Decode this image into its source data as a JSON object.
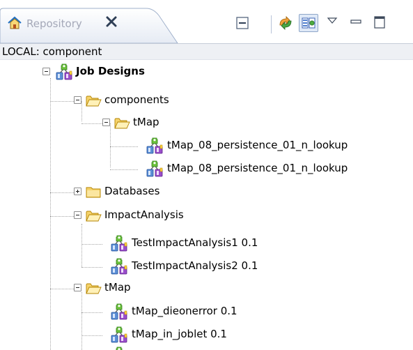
{
  "tab": {
    "title": "Repository",
    "icon": "repository-house-icon"
  },
  "toolbar": [
    {
      "name": "collapse-all-icon"
    },
    {
      "name": "refresh-icon"
    },
    {
      "name": "filter-icon",
      "active": true
    },
    {
      "name": "view-menu-icon"
    },
    {
      "name": "minimize-icon"
    },
    {
      "name": "maximize-icon"
    }
  ],
  "breadcrumb": "LOCAL: component",
  "tree": {
    "job_designs": "Job Designs",
    "components": "components",
    "components_tmap": "tMap",
    "job_lookup_1": "tMap_08_persistence_01_n_lookup",
    "job_lookup_2": "tMap_08_persistence_01_n_lookup",
    "databases": "Databases",
    "impact_analysis": "ImpactAnalysis",
    "test_impact_1": "TestImpactAnalysis1 0.1",
    "test_impact_2": "TestImpactAnalysis2 0.1",
    "tmap": "tMap",
    "tmap_dieonerror": "tMap_dieonerror 0.1",
    "tmap_in_joblet": "tMap_in_joblet 0.1"
  },
  "colors": {
    "tab_label": "#a4a8b8",
    "breadcrumb_bg": "#eef0f4",
    "folder": "#f3cd5a",
    "job_green": "#5fb836",
    "job_purple": "#8a3dbd",
    "job_blue": "#3d78c8"
  }
}
